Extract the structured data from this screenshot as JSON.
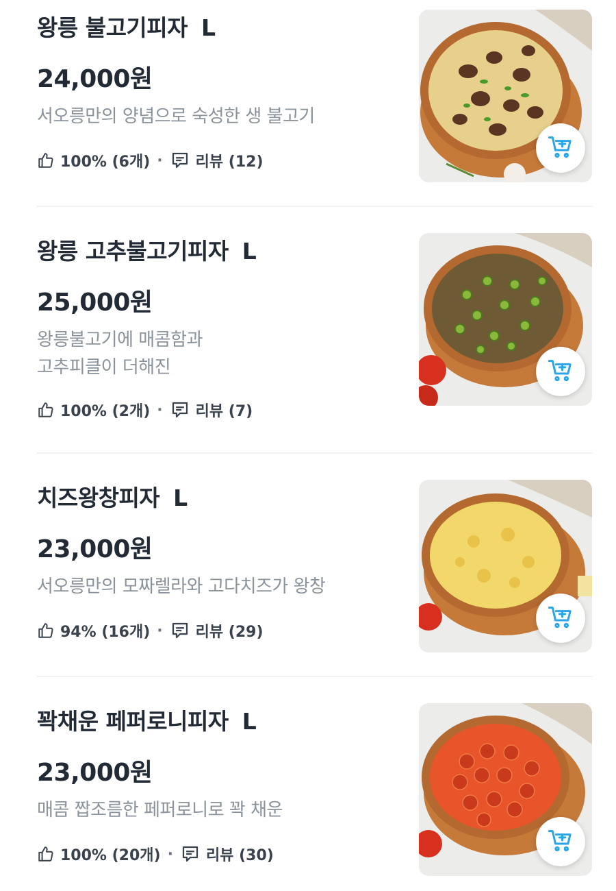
{
  "menu_items": [
    {
      "name": "왕릉 불고기피자",
      "size": "L",
      "price": "24,000원",
      "description": [
        "서오릉만의 양념으로 숙성한 생 불고기"
      ],
      "like_stat": "100% (6개)",
      "separator": "·",
      "review_label": "리뷰 (12)",
      "topping": "bulgogi"
    },
    {
      "name": "왕릉 고추불고기피자",
      "size": "L",
      "price": "25,000원",
      "description": [
        "왕릉불고기에 매콤함과",
        "고추피클이 더해진"
      ],
      "like_stat": "100% (2개)",
      "separator": "·",
      "review_label": "리뷰 (7)",
      "topping": "pepper"
    },
    {
      "name": "치즈왕창피자",
      "size": "L",
      "price": "23,000원",
      "description": [
        "서오릉만의 모짜렐라와 고다치즈가 왕창"
      ],
      "like_stat": "94% (16개)",
      "separator": "·",
      "review_label": "리뷰 (29)",
      "topping": "cheese"
    },
    {
      "name": "꽉채운 페퍼로니피자",
      "size": "L",
      "price": "23,000원",
      "description": [
        "매콤 짭조름한 페퍼로니로 꽉 채운"
      ],
      "like_stat": "100% (20개)",
      "separator": "·",
      "review_label": "리뷰 (30)",
      "topping": "pepperoni"
    }
  ],
  "icons": {
    "like": "thumbs-up-icon",
    "review": "speech-bubble-icon",
    "cart": "cart-add-icon"
  },
  "colors": {
    "title": "#222a35",
    "description": "#8a929c",
    "meta": "#3a424d",
    "cart_accent": "#2aa6e8",
    "divider": "#eef0f3"
  }
}
